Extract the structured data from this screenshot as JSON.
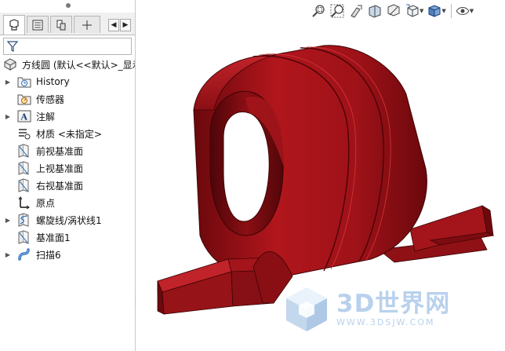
{
  "feature_manager": {
    "root_label": "方线圆 (默认<<默认>_显示",
    "items": [
      {
        "label": "History",
        "icon": "history-folder-icon",
        "expandable": true
      },
      {
        "label": "传感器",
        "icon": "sensor-icon",
        "expandable": false
      },
      {
        "label": "注解",
        "icon": "annotations-icon",
        "expandable": true
      },
      {
        "label": "材质 <未指定>",
        "icon": "material-icon",
        "expandable": false
      },
      {
        "label": "前视基准面",
        "icon": "plane-icon",
        "expandable": false
      },
      {
        "label": "上视基准面",
        "icon": "plane-icon",
        "expandable": false
      },
      {
        "label": "右视基准面",
        "icon": "plane-icon",
        "expandable": false
      },
      {
        "label": "原点",
        "icon": "origin-icon",
        "expandable": false
      },
      {
        "label": "螺旋线/涡状线1",
        "icon": "helix-icon",
        "expandable": true
      },
      {
        "label": "基准面1",
        "icon": "plane-icon",
        "expandable": false
      },
      {
        "label": "扫描6",
        "icon": "sweep-icon",
        "expandable": true
      }
    ]
  },
  "watermark": {
    "brand": "3D世界网",
    "url": "WWW.3DSJW.COM"
  },
  "colors": {
    "part_red": "#9c1218",
    "part_shadow": "#5e070b",
    "part_highlight": "#c8262c",
    "watermark_blue": "#a9c8ea",
    "icon_blue": "#2f6db5"
  }
}
